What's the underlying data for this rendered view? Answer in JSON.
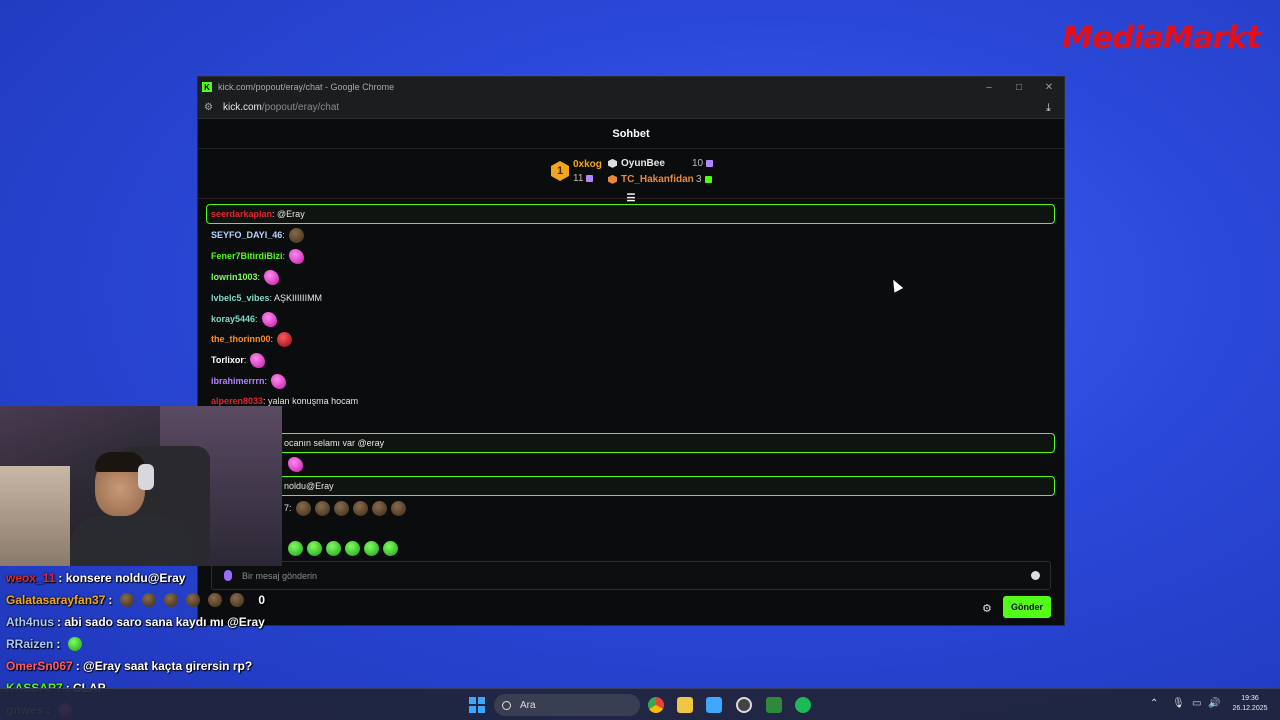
{
  "brand": "MediaMarkt",
  "browser": {
    "title": "kick.com/popout/eray/chat - Google Chrome",
    "url_host": "kick.com",
    "url_path": "/popout/eray/chat",
    "window_controls": [
      "–",
      "□",
      "✕"
    ]
  },
  "chat": {
    "header": "Sohbet",
    "leaderboard": [
      {
        "rank": "1",
        "name": "0xkog",
        "value": "11"
      },
      {
        "name": "OyunBee",
        "value": "10"
      },
      {
        "name": "TC_Hakanfidan",
        "value": "3"
      }
    ],
    "messages": [
      {
        "user": "seerdarkaplan",
        "text": ": @Eray",
        "color": "#e0262f",
        "mention": true
      },
      {
        "user": "SEYFO_DAYI_46",
        "text": ":",
        "color": "#b7d4ff",
        "emotes": [
          "bag"
        ]
      },
      {
        "user": "Fener7BitirdiBizi",
        "text": ":",
        "color": "#53fc18",
        "emotes": [
          "pink"
        ]
      },
      {
        "user": "lowrin1003",
        "text": ":",
        "color": "#7dff5a",
        "emotes": [
          "pink"
        ]
      },
      {
        "user": "lvbelc5_vibes",
        "text": ": AŞKIIIIIIMM",
        "color": "#7fd9c9"
      },
      {
        "user": "koray5446",
        "text": ":",
        "color": "#7fd9c9",
        "emotes": [
          "pink"
        ]
      },
      {
        "user": "the_thorinn00",
        "text": ":",
        "color": "#ff8c2a",
        "emotes": [
          "red"
        ]
      },
      {
        "user": "Torlixor",
        "text": ":",
        "color": "#ffffff",
        "emotes": [
          "pink"
        ]
      },
      {
        "user": "ibrahimerrrn",
        "text": ":",
        "color": "#b083ff",
        "emotes": [
          "pink"
        ]
      },
      {
        "user": "alperen8033",
        "text": ": yalan konuşma hocam",
        "color": "#e0262f"
      },
      {
        "user": "",
        "text": "ocanın selamı var @eray",
        "color": "#ffffff",
        "mention": true
      },
      {
        "user": "",
        "text": "",
        "color": "#ffffff",
        "emotes": [
          "pink"
        ]
      },
      {
        "user": "",
        "text": "noldu@Eray",
        "color": "#ffffff",
        "mention": true
      },
      {
        "user": "",
        "text": "7:",
        "color": "#ffffff",
        "emotes": [
          "bag",
          "bag",
          "bag",
          "bag",
          "bag",
          "bag"
        ]
      },
      {
        "user": "",
        "text": "",
        "color": "#ffffff",
        "emotes": [
          "green",
          "green",
          "green",
          "green",
          "green",
          "green"
        ]
      }
    ],
    "input_placeholder": "Bir mesaj gönderin",
    "send_label": "Gönder"
  },
  "overlay_chat": [
    {
      "user": "weox_11",
      "text": ": konsere noldu@Eray",
      "color": "#e0262f"
    },
    {
      "user": "Galatasarayfan37",
      "text": ":",
      "color": "#f2a81d",
      "emotes": [
        "bag",
        "bag",
        "bag",
        "bag",
        "bag",
        "bag"
      ],
      "tail": "0"
    },
    {
      "user": "Ath4nus",
      "text": ": abi sado saro sana kaydı mı @Eray",
      "color": "#a8c8ff"
    },
    {
      "user": "RRaizen",
      "text": ":",
      "color": "#a8c8ff",
      "emotes": [
        "green"
      ]
    },
    {
      "user": "OmerSn067",
      "text": ": @Eray saat kaçta girersin rp?",
      "color": "#ff5a6a"
    },
    {
      "user": "KASSAP7",
      "text": ": CLAP",
      "color": "#53fc18"
    },
    {
      "user": "gnwes",
      "text": ":",
      "color": "#b8c8ff",
      "emotes": [
        "pink"
      ]
    }
  ],
  "taskbar": {
    "search_placeholder": "Ara",
    "time": "19:36",
    "date": "26.12.2025"
  }
}
